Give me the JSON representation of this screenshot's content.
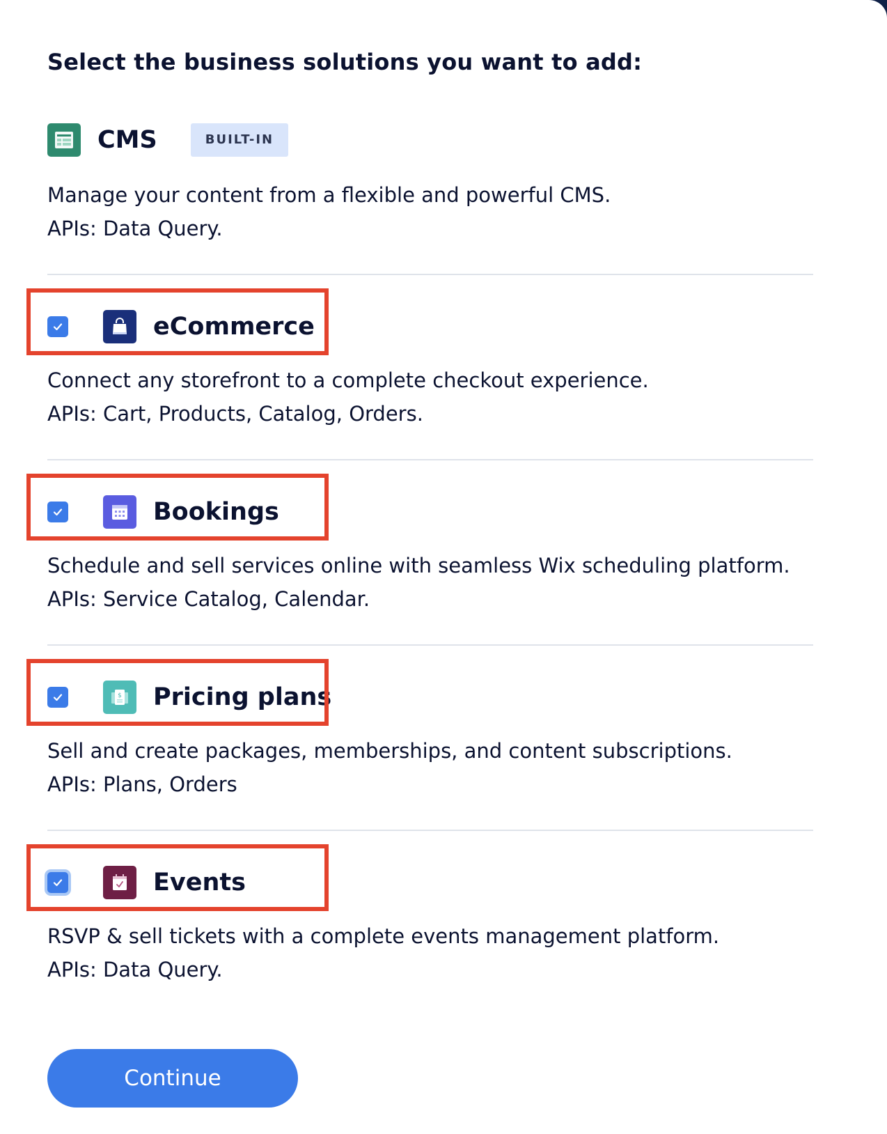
{
  "heading": "Select the business solutions you want to add:",
  "colors": {
    "accent": "#3b7be8",
    "highlight": "#e4432d",
    "badge_bg": "#d9e5fb"
  },
  "cms": {
    "title": "CMS",
    "badge": "BUILT-IN",
    "icon": "cms-table-icon",
    "icon_color": "#2e8a6e",
    "description": "Manage your content from a flexible and powerful CMS.",
    "apis": "APIs: Data Query."
  },
  "solutions": [
    {
      "title": "eCommerce",
      "checked": true,
      "icon": "shopping-bag-icon",
      "icon_color": "#1a2f7a",
      "description": "Connect any storefront to a complete checkout experience.",
      "apis": "APIs: Cart, Products, Catalog, Orders."
    },
    {
      "title": "Bookings",
      "checked": true,
      "icon": "calendar-grid-icon",
      "icon_color": "#5a5ce0",
      "description": "Schedule and sell services online with seamless Wix scheduling platform.",
      "apis": "APIs: Service Catalog, Calendar."
    },
    {
      "title": "Pricing plans",
      "checked": true,
      "icon": "price-tag-icon",
      "icon_color": "#4fbcb6",
      "description": "Sell and create packages, memberships, and content subscriptions.",
      "apis": "APIs: Plans, Orders"
    },
    {
      "title": "Events",
      "checked": true,
      "icon": "calendar-check-icon",
      "icon_color": "#6e1f45",
      "description": "RSVP & sell tickets with a complete events management platform.",
      "apis": "APIs: Data Query."
    }
  ],
  "continue_label": "Continue"
}
